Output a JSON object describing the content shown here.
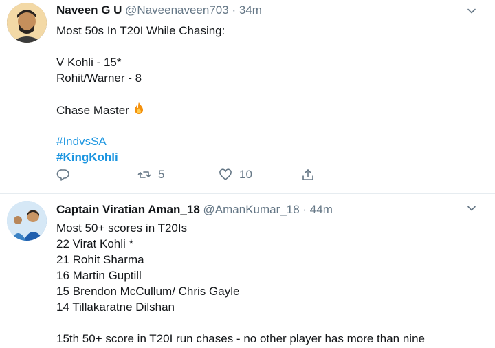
{
  "tweets": [
    {
      "name": "Naveen G U",
      "handle": "@Naveenaveen703",
      "separator": "·",
      "time": "34m",
      "lines": [
        "Most 50s In T20I While Chasing:",
        "",
        "V Kohli - 15*",
        "Rohit/Warner - 8",
        "",
        "Chase Master"
      ],
      "hashtags": [
        "#IndvsSA",
        "#KingKohli"
      ],
      "actions": {
        "retweets": "5",
        "likes": "10"
      }
    },
    {
      "name": "Captain Viratian Aman_18",
      "handle": "@AmanKumar_18",
      "separator": "·",
      "time": "44m",
      "lines": [
        "Most 50+ scores in T20Is",
        "22 Virat Kohli *",
        "21 Rohit Sharma",
        "16 Martin Guptill",
        "15 Brendon McCullum/ Chris Gayle",
        "14 Tillakaratne Dilshan",
        "",
        "15th 50+ score in T20I run chases - no other player has more than nine"
      ]
    }
  ],
  "colors": {
    "text": "#14171a",
    "secondary": "#657786",
    "hashtag": "#1b95e0",
    "divider": "#e6ecf0"
  },
  "icons": [
    "chevron-down-icon",
    "reply-icon",
    "retweet-icon",
    "like-icon",
    "share-icon",
    "fire-emoji-icon"
  ]
}
